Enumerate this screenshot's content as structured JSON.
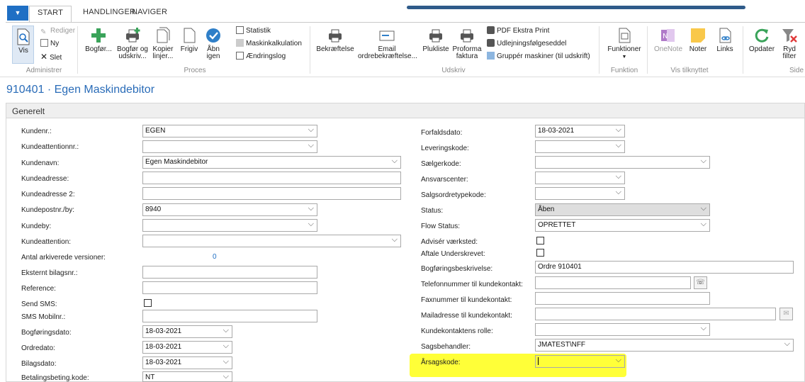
{
  "tabs": [
    {
      "label": "START"
    },
    {
      "label": "HANDLINGER"
    },
    {
      "label": "NAVIGER"
    }
  ],
  "ribbon": {
    "administrer": {
      "vis": "Vis",
      "rediger": "Rediger",
      "ny": "Ny",
      "slet": "Slet",
      "group": "Administrer"
    },
    "proces": {
      "bogfor": "Bogfør...",
      "bogfor_udskriv_1": "Bogfør og",
      "bogfor_udskriv_2": "udskriv...",
      "kopier_1": "Kopier",
      "kopier_2": "linjer...",
      "frigiv": "Frigiv",
      "abn_1": "Åbn",
      "abn_2": "igen",
      "statistik": "Statistik",
      "maskinkalkulation": "Maskinkalkulation",
      "aendringslog": "Ændringslog",
      "group": "Proces"
    },
    "udskriv": {
      "bekraeftelse": "Bekræftelse",
      "email_1": "Email",
      "email_2": "ordrebekræftelse...",
      "plukliste": "Plukliste",
      "proforma_1": "Proforma",
      "proforma_2": "faktura",
      "pdf_ekstra": "PDF Ekstra Print",
      "udlejning": "Udlejningsfølgeseddel",
      "grupper": "Gruppér maskiner (til udskrift)",
      "group": "Udskriv"
    },
    "funktion": {
      "funktioner": "Funktioner",
      "group": "Funktion"
    },
    "vis_tilknyttet": {
      "onenote": "OneNote",
      "noter": "Noter",
      "links": "Links",
      "group": "Vis tilknyttet"
    },
    "side": {
      "opdater": "Opdater",
      "ryd_1": "Ryd",
      "ryd_2": "filter",
      "group": "Side"
    }
  },
  "page": {
    "title": "910401 · Egen Maskindebitor",
    "section": "Generelt"
  },
  "left": {
    "kundenr_label": "Kundenr.:",
    "kundenr_value": "EGEN",
    "kundeattentionnr_label": "Kundeattentionnr.:",
    "kundenavn_label": "Kundenavn:",
    "kundenavn_value": "Egen Maskindebitor",
    "kundeadresse_label": "Kundeadresse:",
    "kundeadresse2_label": "Kundeadresse 2:",
    "kundepostnr_label": "Kundepostnr./by:",
    "kundepostnr_value": "8940",
    "kundeby_label": "Kundeby:",
    "kundeattention_label": "Kundeattention:",
    "arkiverede_label": "Antal arkiverede versioner:",
    "arkiverede_value": "0",
    "eksternt_label": "Eksternt bilagsnr.:",
    "reference_label": "Reference:",
    "sendsms_label": "Send SMS:",
    "smsmobil_label": "SMS Mobilnr.:",
    "bogforingsdato_label": "Bogføringsdato:",
    "bogforingsdato_value": "18-03-2021",
    "ordredato_label": "Ordredato:",
    "ordredato_value": "18-03-2021",
    "bilagsdato_label": "Bilagsdato:",
    "bilagsdato_value": "18-03-2021",
    "betaling_label": "Betalingsbeting.kode:",
    "betaling_value": "NT"
  },
  "right": {
    "forfaldsdato_label": "Forfaldsdato:",
    "forfaldsdato_value": "18-03-2021",
    "leveringskode_label": "Leveringskode:",
    "saelgerkode_label": "Sælgerkode:",
    "ansvarscenter_label": "Ansvarscenter:",
    "salgsordretype_label": "Salgsordretypekode:",
    "status_label": "Status:",
    "status_value": "Åben",
    "flowstatus_label": "Flow Status:",
    "flowstatus_value": "OPRETTET",
    "advis_label": "Advisér værksted:",
    "aftale_label": "Aftale Underskrevet:",
    "bogforingsbeskrivelse_label": "Bogføringsbeskrivelse:",
    "bogforingsbeskrivelse_value": "Ordre 910401",
    "telefon_label": "Telefonnummer til kundekontakt:",
    "fax_label": "Faxnummer til kundekontakt:",
    "mail_label": "Mailadresse til kundekontakt:",
    "rolle_label": "Kundekontaktens rolle:",
    "sagsbehandler_label": "Sagsbehandler:",
    "sagsbehandler_value": "JMATEST\\NFF",
    "arsagskode_label": "Årsagskode:"
  },
  "colors": {
    "accent": "#1f6fc4",
    "title": "#2a6cb8",
    "highlight": "#ffff38"
  }
}
